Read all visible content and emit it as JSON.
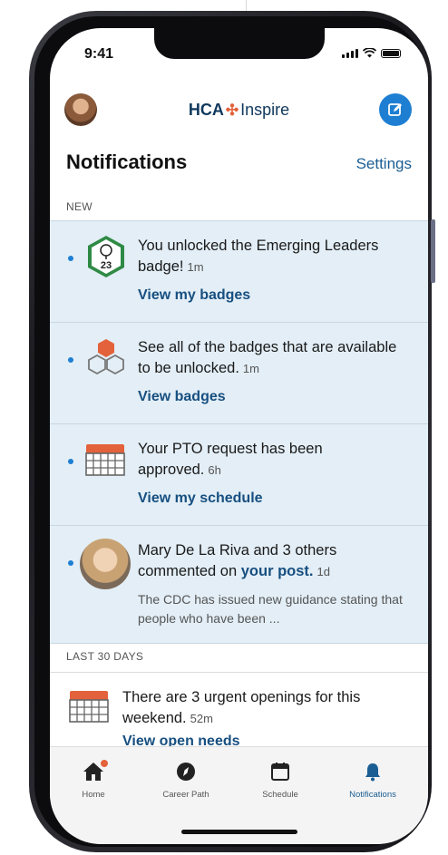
{
  "status_bar": {
    "time": "9:41"
  },
  "header": {
    "brand_left": "HCA",
    "brand_right": "Inspire",
    "avatar": "user-avatar",
    "compose_icon": "compose-icon"
  },
  "page": {
    "title": "Notifications",
    "settings_label": "Settings"
  },
  "sections": {
    "new": "NEW",
    "last30": "LAST 30 DAYS"
  },
  "notifications_new": [
    {
      "icon": "badge-icon",
      "badge_number": "23",
      "text": "You unlocked the Emerging Leaders badge!",
      "time": "1m",
      "action": "View my badges"
    },
    {
      "icon": "hexagons-icon",
      "text": "See all of the badges that are available to be unlocked.",
      "time": "1m",
      "action": "View badges"
    },
    {
      "icon": "calendar-icon",
      "text": "Your PTO request has been approved.",
      "time": "6h",
      "action": "View my schedule"
    },
    {
      "icon": "user-avatar",
      "text": "Mary De La Riva and 3 others commented on ",
      "link": "your post.",
      "time": "1d",
      "snippet": "The CDC has issued new guidance stating that people who have been ..."
    }
  ],
  "notifications_older": [
    {
      "icon": "calendar-icon",
      "text": "There are 3 urgent openings for this weekend.",
      "time": "52m",
      "action": "View open needs"
    }
  ],
  "tabs": [
    {
      "label": "Home",
      "icon": "home-icon",
      "badge": true
    },
    {
      "label": "Career Path",
      "icon": "compass-icon"
    },
    {
      "label": "Schedule",
      "icon": "calendar-icon"
    },
    {
      "label": "Notifications",
      "icon": "bell-icon",
      "active": true
    }
  ],
  "colors": {
    "accent": "#1e7fd2",
    "link": "#174f80",
    "unread_bg": "#e3eef6",
    "brand_orange": "#e3623b"
  }
}
